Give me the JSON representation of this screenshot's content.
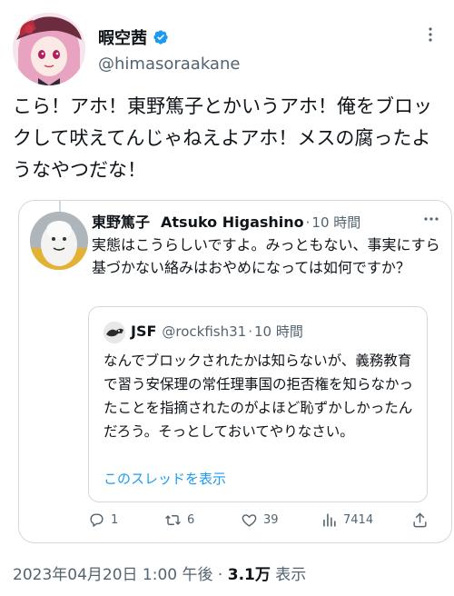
{
  "author": {
    "name": "暇空茜",
    "handle": "@himasoraakane",
    "verified_color": "#1d9bf0"
  },
  "tweet": {
    "text": "こら！アホ！東野篤子とかいうアホ！俺をブロックして吠えてんじゃねえよアホ！メスの腐ったようなやつだな！"
  },
  "quote": {
    "name_jp": "東野篤子",
    "name_en": "Atsuko Higashino",
    "separator": "·",
    "time": "10 時間",
    "text": "実態はこうらしいですよ。みっともない、事実にすら基づかない絡みはおやめになっては如何ですか？",
    "nested": {
      "name": "JSF",
      "handle": "@rockfish31",
      "separator": "·",
      "time": "10 時間",
      "text": "なんでブロックされたかは知らないが、義務教育で習う安保理の常任理事国の拒否権を知らなかったことを指摘されたのがよほど恥ずかしかったんだろう。そっとしておいてやりなさい。",
      "show_thread": "このスレッドを表示"
    },
    "actions": {
      "replies": "1",
      "retweets": "6",
      "likes": "39",
      "views": "7414"
    }
  },
  "meta": {
    "timestamp": "2023年04月20日 1:00 午後",
    "separator": " · ",
    "views_count": "3.1万",
    "views_label": " 表示"
  },
  "icons": {
    "more": "more-horizontal-icon",
    "verified": "verified-badge-icon",
    "reply": "reply-icon",
    "retweet": "retweet-icon",
    "like": "heart-icon",
    "views": "views-chart-icon",
    "share": "share-icon"
  },
  "colors": {
    "text": "#0f1419",
    "secondary": "#536471",
    "link": "#1d9bf0",
    "border": "#cfd9de"
  }
}
